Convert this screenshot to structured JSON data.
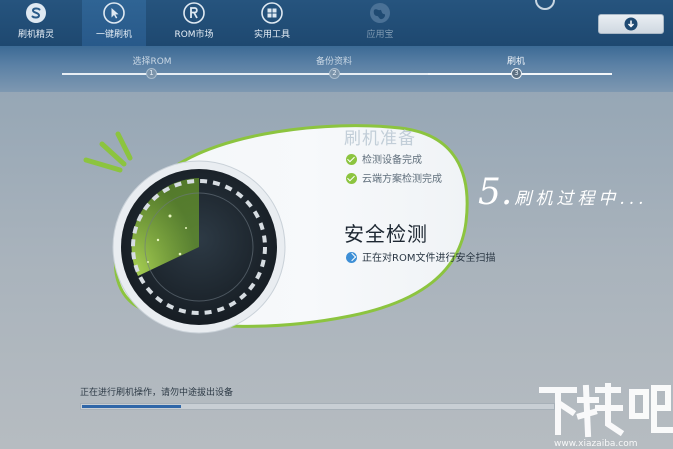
{
  "nav": {
    "items": [
      {
        "label": "刷机精灵",
        "icon": "brand-s-icon"
      },
      {
        "label": "一键刷机",
        "icon": "cursor-icon"
      },
      {
        "label": "ROM市场",
        "icon": "rom-r-icon"
      },
      {
        "label": "实用工具",
        "icon": "grid-icon"
      },
      {
        "label": "应用宝",
        "icon": "globe-icon"
      }
    ],
    "active_index": 1
  },
  "steps": {
    "items": [
      {
        "label": "选择ROM",
        "number": "1"
      },
      {
        "label": "备份资料",
        "number": "2"
      },
      {
        "label": "刷机",
        "number": "3"
      }
    ],
    "current": 3
  },
  "panel": {
    "faded_title": "刷机准备",
    "checks": [
      "检测设备完成",
      "云端方案检测完成"
    ],
    "main_title": "安全检测",
    "sub_status": "正在对ROM文件进行安全扫描"
  },
  "caption": {
    "number": "5.",
    "text": "刷机过程中..."
  },
  "footer": {
    "status_text": "正在进行刷机操作，请勿中途拔出设备",
    "progress": 0.21
  },
  "watermark": {
    "text": "下载吧",
    "url": "www.xiazaiba.com"
  },
  "colors": {
    "accent_green": "#8cc43f",
    "nav_blue": "#26547e",
    "progress_blue": "#2f66a8"
  }
}
